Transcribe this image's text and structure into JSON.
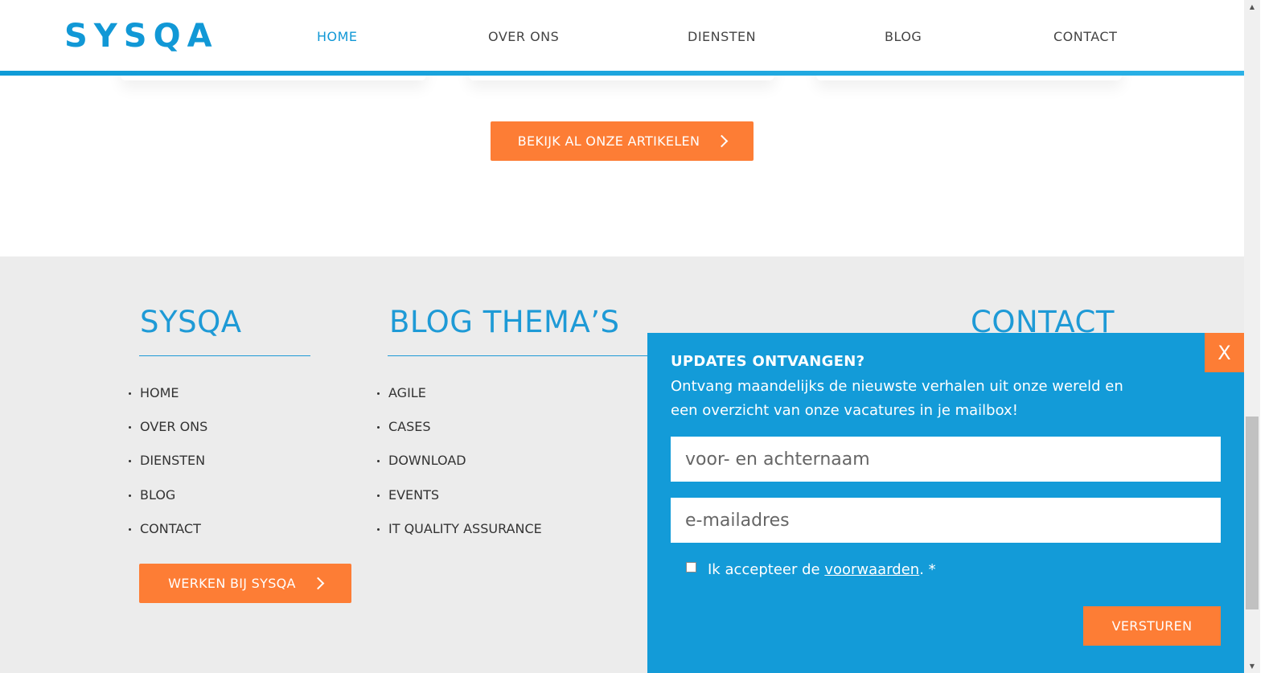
{
  "header": {
    "logo": "SYSQA",
    "nav": [
      "HOME",
      "OVER ONS",
      "DIENSTEN",
      "BLOG",
      "CONTACT"
    ],
    "active_nav": "HOME"
  },
  "main": {
    "all_articles_button": "BEKIJK AL ONZE ARTIKELEN"
  },
  "footer": {
    "sysqa": {
      "title": "SYSQA",
      "links": [
        "HOME",
        "OVER ONS",
        "DIENSTEN",
        "BLOG",
        "CONTACT"
      ],
      "button": "WERKEN BIJ SYSQA"
    },
    "blog_themes": {
      "title": "BLOG THEMA’S",
      "links": [
        "AGILE",
        "CASES",
        "DOWNLOAD",
        "EVENTS",
        "IT QUALITY ASSURANCE"
      ]
    },
    "contact": {
      "title": "CONTACT"
    }
  },
  "popup": {
    "close_label": "X",
    "title": "UPDATES ONTVANGEN?",
    "description": "Ontvang maandelijks de nieuwste verhalen uit onze wereld en een overzicht van onze vacatures in je mailbox!",
    "name_placeholder": "voor- en achternaam",
    "email_placeholder": "e-mailadres",
    "consent_prefix": "Ik accepteer de ",
    "consent_link": "voorwaarden",
    "consent_suffix": ". *",
    "consent_checked": false,
    "submit_label": "VERSTUREN"
  },
  "colors": {
    "brand_blue": "#1198d6",
    "popup_blue": "#139bd8",
    "accent_orange": "#fd7d35",
    "footer_bg": "#ececec"
  }
}
